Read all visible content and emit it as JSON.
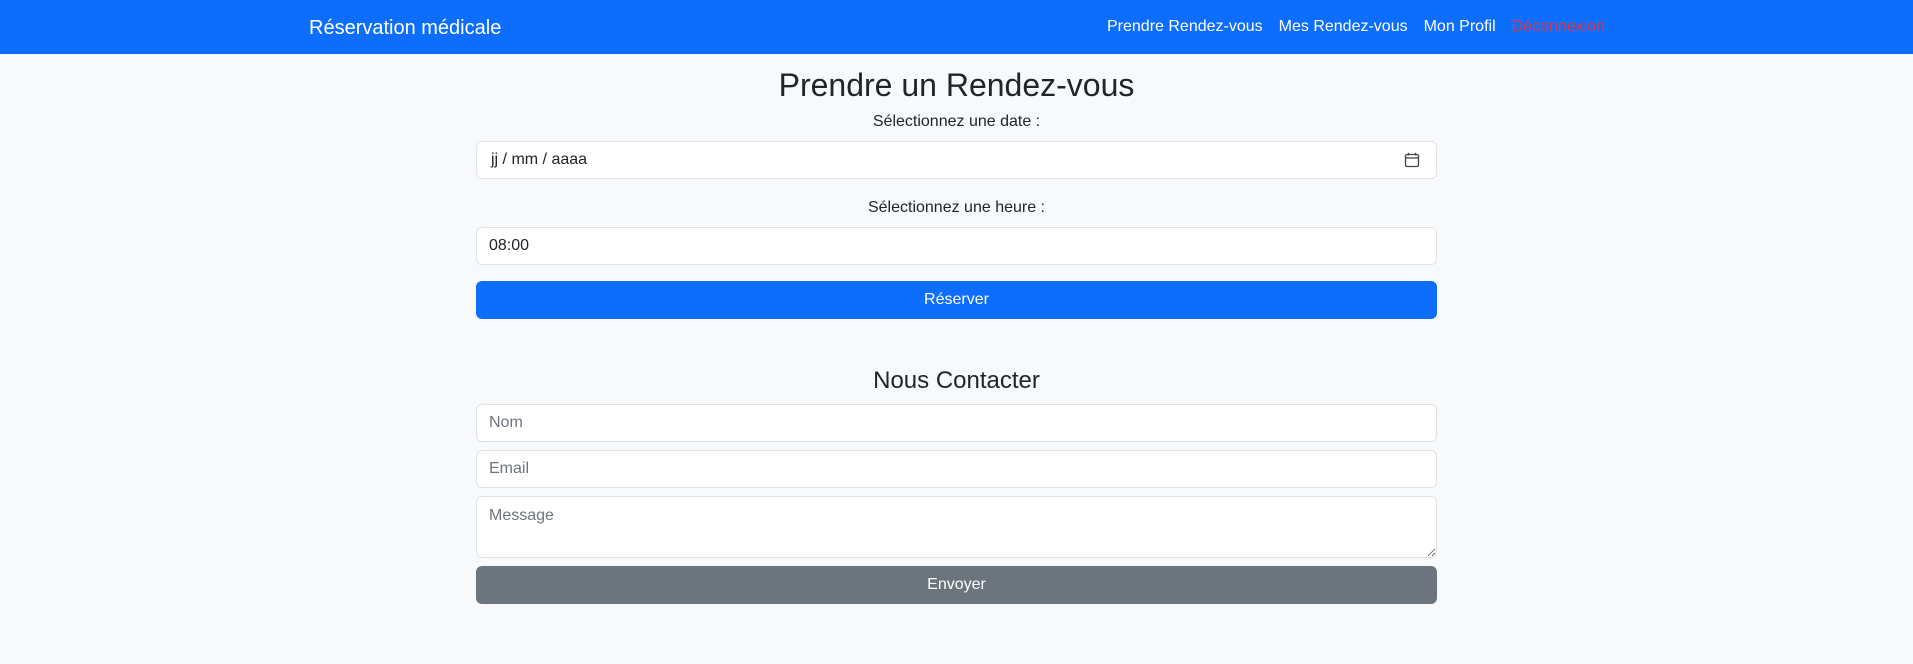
{
  "navbar": {
    "brand": "Réservation médicale",
    "links": [
      {
        "label": "Prendre Rendez-vous"
      },
      {
        "label": "Mes Rendez-vous"
      },
      {
        "label": "Mon Profil"
      },
      {
        "label": "Déconnexion"
      }
    ],
    "logout_color": "#dc3545",
    "bg_color": "#0d6efd"
  },
  "booking": {
    "title": "Prendre un Rendez-vous",
    "date_label": "Sélectionnez une date :",
    "date_value": "jj / mm / aaaa",
    "date_icon": "calendar-icon",
    "time_label": "Sélectionnez une heure :",
    "time_value": "08:00",
    "submit_label": "Réserver"
  },
  "contact": {
    "title": "Nous Contacter",
    "name_placeholder": "Nom",
    "email_placeholder": "Email",
    "message_placeholder": "Message",
    "submit_label": "Envoyer"
  },
  "colors": {
    "primary": "#0d6efd",
    "secondary": "#6c757d",
    "background": "#f8f9fa"
  }
}
